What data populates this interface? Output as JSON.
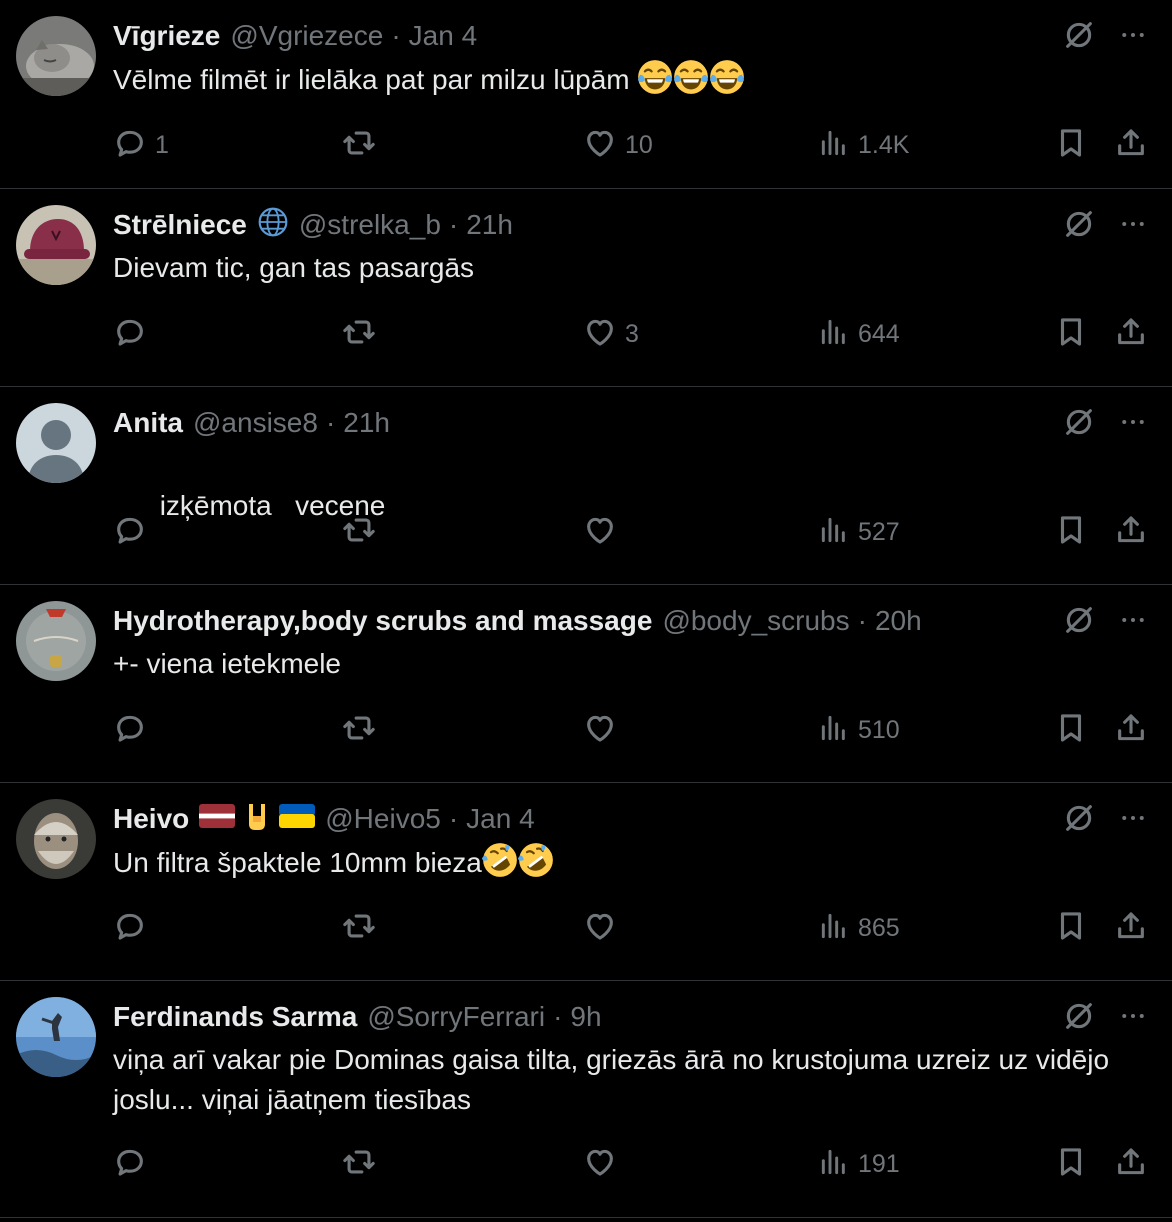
{
  "colors": {
    "background": "#000000",
    "text": "#e7e9ea",
    "muted": "#71767b",
    "divider": "#2f3336"
  },
  "icons": {
    "reply": "speech-bubble-icon",
    "retweet": "retweet-arrows-icon",
    "like": "heart-icon",
    "views": "bar-chart-icon",
    "bookmark": "bookmark-icon",
    "share": "share-upload-icon",
    "grok": "slashed-circle-icon",
    "more": "three-dots-icon"
  },
  "tweets": [
    {
      "name": "Vīgrieze",
      "handle": "@Vgriezece",
      "sep": "·",
      "time": "Jan 4",
      "text": "Vēlme filmēt ir lielāka pat par milzu lūpām",
      "emoji": [
        "😂",
        "😂",
        "😂"
      ],
      "replies": "1",
      "retweets": "",
      "likes": "10",
      "views": "1.4K"
    },
    {
      "name": "Strēlniece",
      "badge": "🌐",
      "handle": "@strelka_b",
      "sep": "·",
      "time": "21h",
      "text": "Dievam tic, gan tas pasargās",
      "replies": "",
      "retweets": "",
      "likes": "3",
      "views": "644"
    },
    {
      "name": "Anita",
      "handle": "@ansise8",
      "sep": "·",
      "time": "21h",
      "text": "izķēmota   vecene",
      "replies": "",
      "retweets": "",
      "likes": "",
      "views": "527"
    },
    {
      "name": "Hydrotherapy,body scrubs and massage",
      "handle": "@body_scrubs",
      "sep": "·",
      "time": "20h",
      "text": "+- viena ietekmele",
      "replies": "",
      "retweets": "",
      "likes": "",
      "views": "510"
    },
    {
      "name": "Heivo",
      "badges": [
        "latvia-flag",
        "🤘",
        "ukraine-flag"
      ],
      "handle": "@Heivo5",
      "sep": "·",
      "time": "Jan 4",
      "text": "Un filtra špaktele 10mm bieza",
      "emoji": [
        "🤣",
        "🤣"
      ],
      "replies": "",
      "retweets": "",
      "likes": "",
      "views": "865"
    },
    {
      "name": "Ferdinands Sarma",
      "handle": "@SorryFerrari",
      "sep": "·",
      "time": "9h",
      "text": "viņa arī vakar pie Dominas gaisa tilta, griezās ārā no krustojuma uzreiz uz vidējo joslu... viņai jāatņem tiesības",
      "replies": "",
      "retweets": "",
      "likes": "",
      "views": "191"
    }
  ]
}
